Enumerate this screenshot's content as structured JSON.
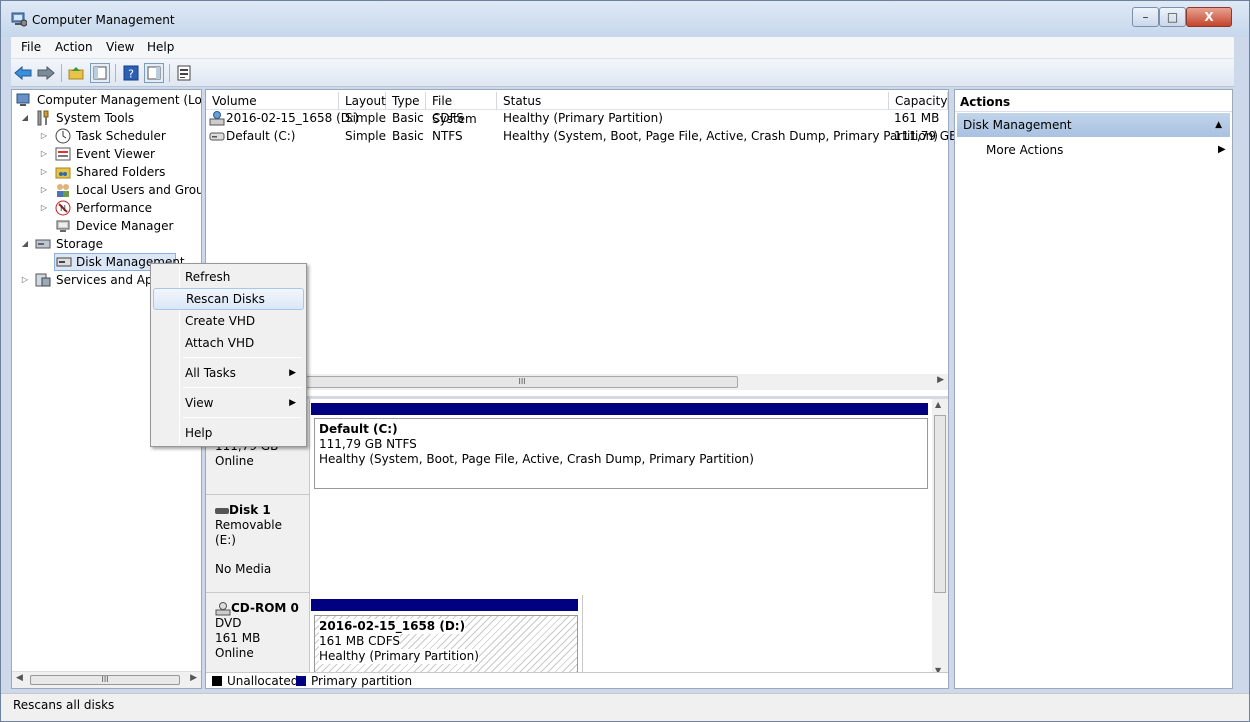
{
  "window": {
    "title": "Computer Management",
    "min": "–",
    "max": "□",
    "close": "X"
  },
  "menubar": {
    "items": [
      "File",
      "Action",
      "View",
      "Help"
    ]
  },
  "tree": {
    "items": [
      {
        "label": "Computer Management (Local",
        "arrow": ""
      },
      {
        "label": "System Tools",
        "arrow": "◢"
      },
      {
        "label": "Task Scheduler",
        "arrow": "▷"
      },
      {
        "label": "Event Viewer",
        "arrow": "▷"
      },
      {
        "label": "Shared Folders",
        "arrow": "▷"
      },
      {
        "label": "Local Users and Groups",
        "arrow": "▷"
      },
      {
        "label": "Performance",
        "arrow": "▷"
      },
      {
        "label": "Device Manager",
        "arrow": ""
      },
      {
        "label": "Storage",
        "arrow": "◢"
      },
      {
        "label": "Disk Management",
        "arrow": ""
      },
      {
        "label": "Services and Appl",
        "arrow": "▷"
      }
    ],
    "scroll_thumb": "III"
  },
  "volumes": {
    "columns": [
      "Volume",
      "Layout",
      "Type",
      "File System",
      "Status",
      "Capacity"
    ],
    "rows": [
      {
        "volume": "2016-02-15_1658 (D:)",
        "layout": "Simple",
        "type": "Basic",
        "fs": "CDFS",
        "status": "Healthy (Primary Partition)",
        "capacity": "161 MB"
      },
      {
        "volume": "Default (C:)",
        "layout": "Simple",
        "type": "Basic",
        "fs": "NTFS",
        "status": "Healthy (System, Boot, Page File, Active, Crash Dump, Primary Partition)",
        "capacity": "111,79 GB"
      }
    ],
    "scroll_thumb": "III"
  },
  "disks": {
    "disk0": {
      "size": "111,79 GB",
      "state": "Online",
      "part_name": "Default  (C:)",
      "part_size": "111,79 GB NTFS",
      "part_status": "Healthy (System, Boot, Page File, Active, Crash Dump, Primary Partition)"
    },
    "disk1": {
      "name": "Disk 1",
      "type": "Removable (E:)",
      "state": "No Media"
    },
    "cdrom": {
      "name": "CD-ROM 0",
      "type": "DVD",
      "size": "161 MB",
      "state": "Online",
      "part_name": "2016-02-15_1658  (D:)",
      "part_size": "161 MB CDFS",
      "part_status": "Healthy (Primary Partition)"
    }
  },
  "legend": {
    "unallocated": "Unallocated",
    "primary": "Primary partition"
  },
  "actions": {
    "title": "Actions",
    "section": "Disk Management",
    "more": "More Actions"
  },
  "context_menu": {
    "items": [
      "Refresh",
      "Rescan Disks",
      "Create VHD",
      "Attach VHD",
      "All Tasks",
      "View",
      "Help"
    ],
    "highlighted": "Rescan Disks"
  },
  "status": {
    "text": "Rescans all disks"
  },
  "colors": {
    "stripe": "#000080",
    "selection": "#dbe7f7"
  }
}
